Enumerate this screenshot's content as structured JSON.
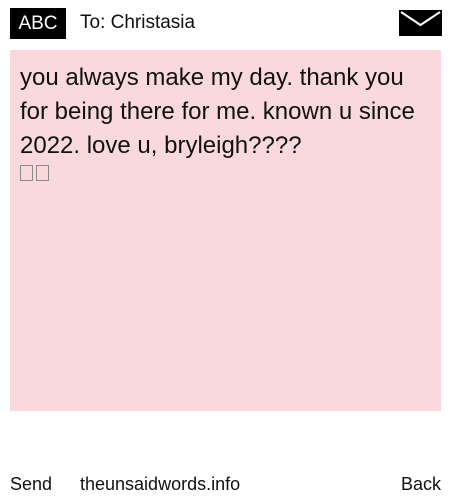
{
  "header": {
    "mode_label": "ABC",
    "recipient_label": "To: Christasia",
    "send_icon": "envelope-icon"
  },
  "message": {
    "text": "you always make my day. thank you for being there for me. known u since  2022. love u, bryleigh????",
    "unrendered_glyphs": 2
  },
  "footer": {
    "left_label": "Send",
    "center_label": "theunsaidwords.info",
    "right_label": "Back"
  },
  "colors": {
    "message_background": "#f9d9dc",
    "badge_background": "#000000",
    "text": "#111111"
  }
}
